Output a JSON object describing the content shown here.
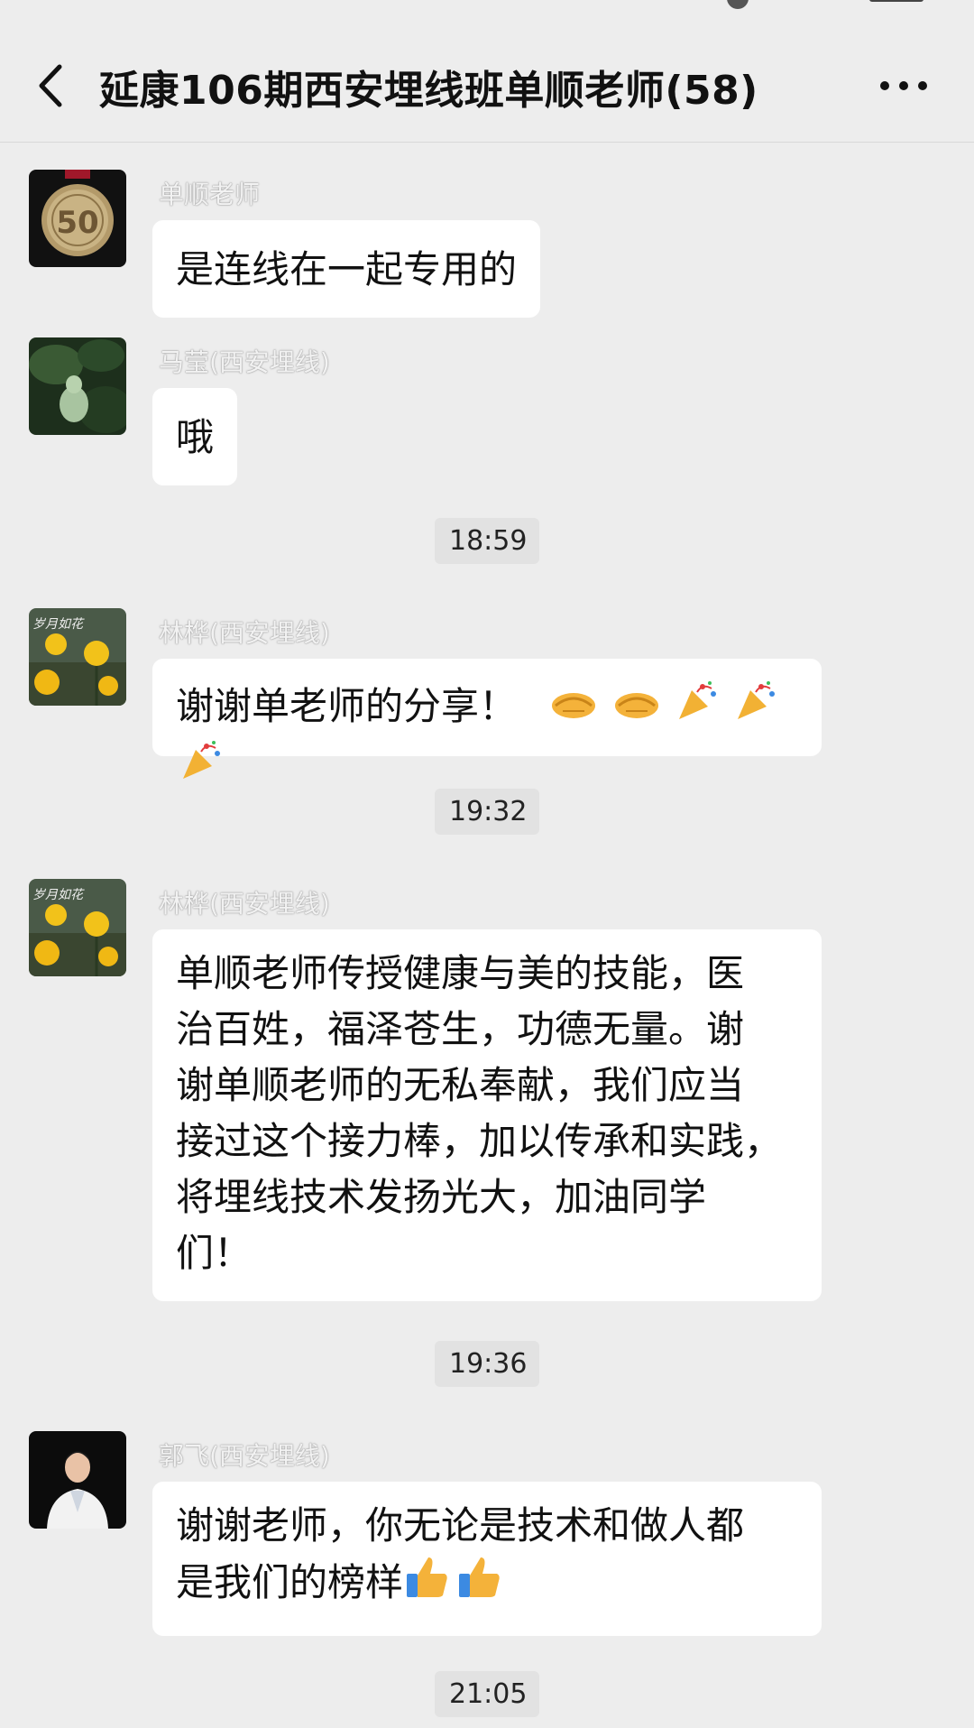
{
  "header": {
    "title": "延康106期西安埋线班单顺老师(58)"
  },
  "messages": [
    {
      "sender": "单顺老师",
      "text": "是连线在一起专用的",
      "avatar": "medal-avatar"
    },
    {
      "sender": "马莹(西安埋线)",
      "text": "哦",
      "avatar": "plant-avatar"
    },
    {
      "sender": "林桦(西安埋线)",
      "text": "谢谢单老师的分享！",
      "avatar": "flowers-avatar",
      "emojis": [
        "handshake-emoji",
        "handshake-emoji",
        "party-popper-emoji",
        "party-popper-emoji",
        "party-popper-emoji"
      ]
    },
    {
      "sender": "林桦(西安埋线)",
      "lines": [
        "单顺老师传授健康与美的技能，医",
        "治百姓，福泽苍生，功德无量。谢",
        "谢单顺老师的无私奉献，我们应当",
        "接过这个接力棒，加以传承和实践，",
        "将埋线技术发扬光大，加油同学",
        "们！"
      ],
      "avatar": "flowers-avatar"
    },
    {
      "sender": "郭飞(西安埋线)",
      "lines": [
        "谢谢老师，你无论是技术和做人都",
        "是我们的榜样"
      ],
      "avatar": "doctor-avatar",
      "emojis": [
        "thumbs-up-emoji",
        "thumbs-up-emoji"
      ]
    }
  ],
  "timestamps": [
    "18:59",
    "19:32",
    "19:36",
    "21:05"
  ],
  "colors": {
    "background": "#ededed",
    "bubble": "#ffffff",
    "timestamp_bg": "#e2e2e2"
  }
}
